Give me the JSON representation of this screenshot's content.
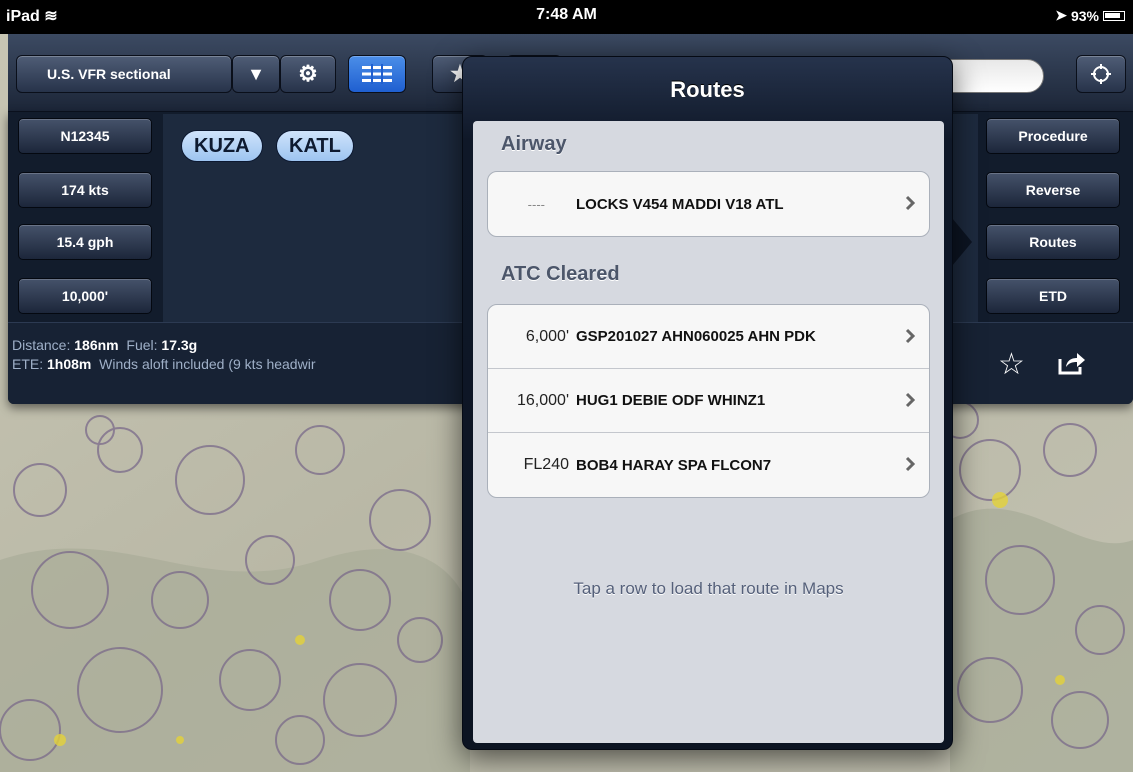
{
  "status_bar": {
    "device": "iPad",
    "time": "7:48 AM",
    "battery": "93%"
  },
  "toolbar": {
    "layer": "U.S. VFR sectional"
  },
  "flight_plan": {
    "left_buttons": [
      "N12345",
      "174 kts",
      "15.4 gph",
      "10,000'"
    ],
    "right_buttons": [
      "Procedure",
      "Reverse",
      "Routes",
      "ETD"
    ],
    "waypoints": [
      "KUZA",
      "KATL"
    ],
    "info": {
      "distance_label": "Distance:",
      "distance": "186nm",
      "fuel_label": "Fuel:",
      "fuel": "17.3g",
      "ete_label": "ETE:",
      "ete": "1h08m",
      "winds": "Winds aloft included (9 kts headwir"
    }
  },
  "routes_popover": {
    "title": "Routes",
    "airway_header": "Airway",
    "airway_rows": [
      {
        "altitude": "----",
        "route": "LOCKS V454 MADDI V18 ATL"
      }
    ],
    "atc_header": "ATC Cleared",
    "atc_rows": [
      {
        "altitude": "6,000'",
        "route": "GSP201027 AHN060025 AHN PDK"
      },
      {
        "altitude": "16,000'",
        "route": "HUG1 DEBIE ODF WHINZ1"
      },
      {
        "altitude": "FL240",
        "route": "BOB4 HARAY SPA FLCON7"
      }
    ],
    "footnote": "Tap a row to load that route in Maps"
  }
}
